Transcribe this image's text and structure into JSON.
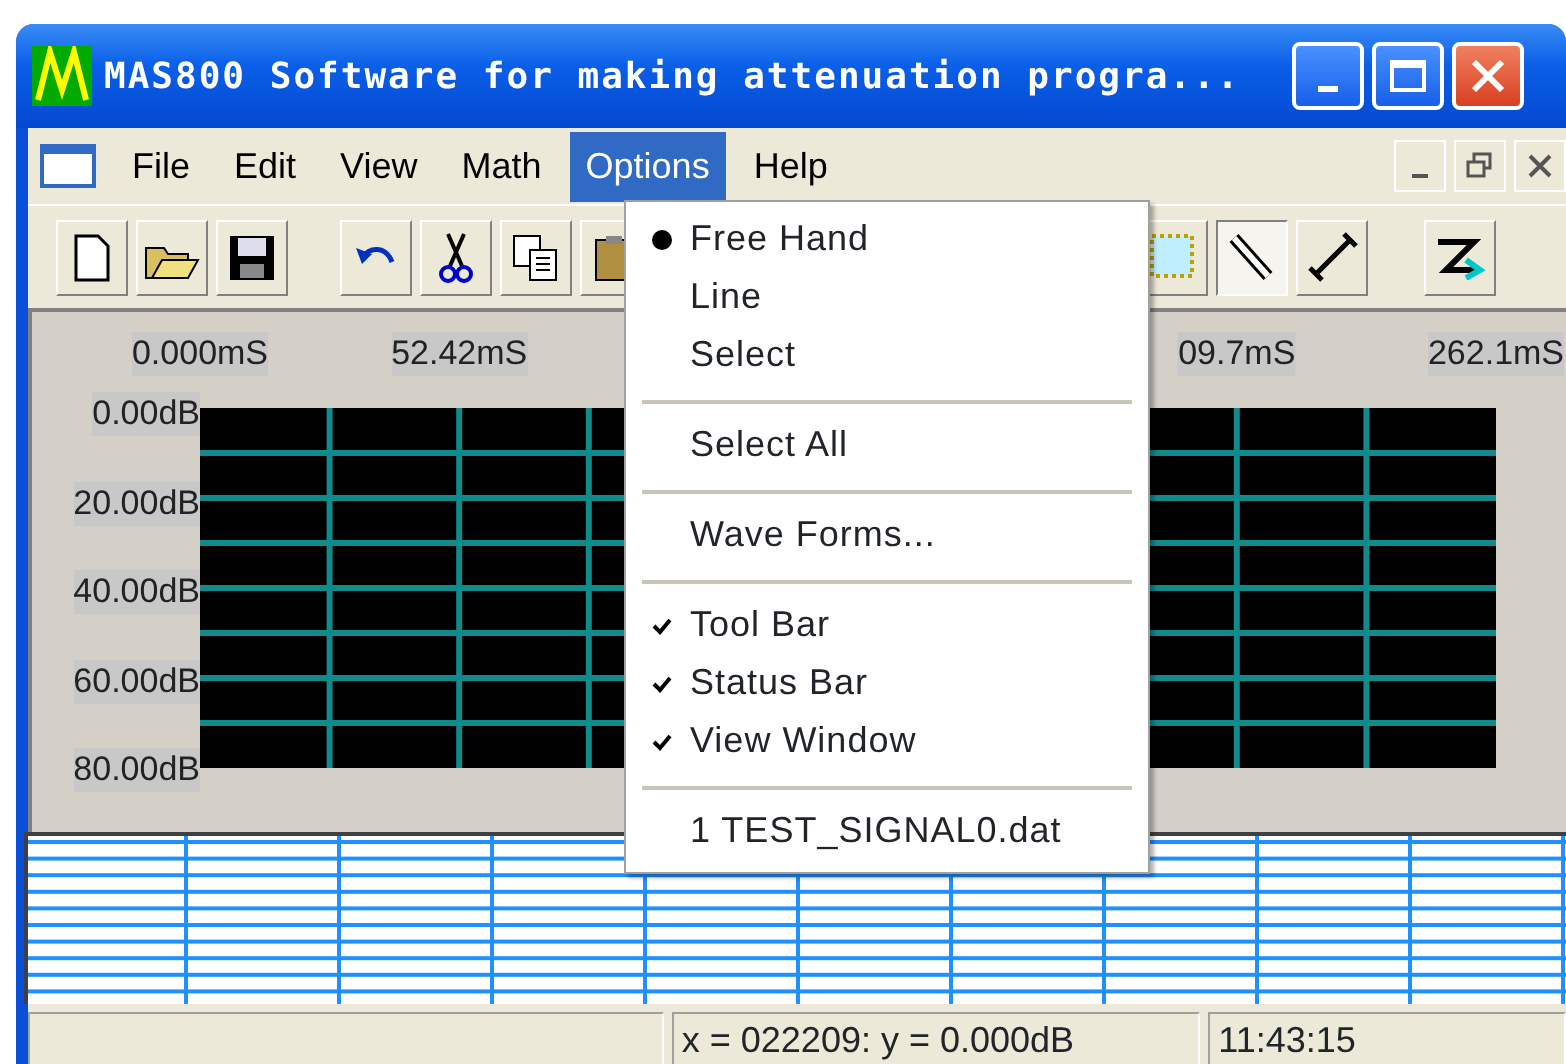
{
  "window": {
    "title": "MAS800 Software for making attenuation progra..."
  },
  "menu": [
    {
      "label": "File",
      "selected": false
    },
    {
      "label": "Edit",
      "selected": false
    },
    {
      "label": "View",
      "selected": false
    },
    {
      "label": "Math",
      "selected": false
    },
    {
      "label": "Options",
      "selected": true
    },
    {
      "label": "Help",
      "selected": false
    }
  ],
  "dropdown": [
    {
      "kind": "radio",
      "label": "Free Hand",
      "checked": true
    },
    {
      "kind": "radio",
      "label": "Line",
      "checked": false
    },
    {
      "kind": "radio",
      "label": "Select",
      "checked": false
    },
    {
      "kind": "separator"
    },
    {
      "kind": "item",
      "label": "Select All"
    },
    {
      "kind": "separator"
    },
    {
      "kind": "item",
      "label": "Wave Forms..."
    },
    {
      "kind": "separator"
    },
    {
      "kind": "check",
      "label": "Tool Bar",
      "checked": true
    },
    {
      "kind": "check",
      "label": "Status Bar",
      "checked": true
    },
    {
      "kind": "check",
      "label": "View Window",
      "checked": true
    },
    {
      "kind": "separator"
    },
    {
      "kind": "item",
      "label": "1 TEST_SIGNAL0.dat"
    }
  ],
  "tools": [
    {
      "kind": "select",
      "selected": false
    },
    {
      "kind": "pencil",
      "selected": true
    },
    {
      "kind": "line",
      "selected": false
    }
  ],
  "time_axis": [
    "0.000mS",
    "52.42mS",
    "09.7mS",
    "262.1mS"
  ],
  "level_axis": [
    "0.00dB",
    "20.00dB",
    "40.00dB",
    "60.00dB",
    "80.00dB"
  ],
  "status_bar": {
    "position": "x = 022209: y = 0.000dB",
    "time": "11:43:15"
  }
}
